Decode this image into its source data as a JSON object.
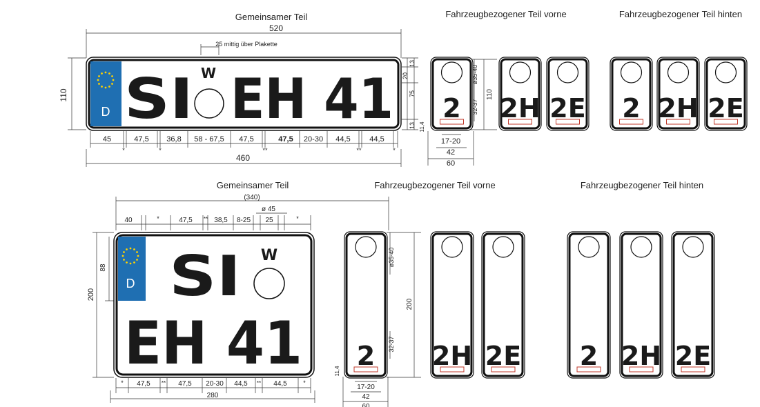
{
  "colors": {
    "eu_band": "#1f6fb2",
    "stars": "#ffd200",
    "plate_border": "#111111",
    "sticker_red": "#c0392b",
    "dim_line": "#333333"
  },
  "top": {
    "headings": {
      "common": "Gemeinsamer Teil",
      "front": "Fahrzeugbezogener Teil vorne",
      "rear": "Fahrzeugbezogener Teil hinten"
    },
    "plate": {
      "eu_letter": "D",
      "text_left": "SI",
      "text_right": "EH 41",
      "w_mark": "W"
    },
    "dims": {
      "overall_width": "520",
      "inner_width": "460",
      "height": "110",
      "badge_note": "25 mittig über Plakette",
      "right_side": [
        "20",
        "13",
        "75",
        "13"
      ],
      "bottom": [
        "45",
        "47,5",
        "36,8",
        "58 - 67,5",
        "47,5",
        "47,5",
        "20-30",
        "44,5",
        "44,5"
      ],
      "stars": [
        "*",
        "*",
        "**",
        "**",
        "*"
      ],
      "tab_side": [
        "ø35-40",
        "32-37",
        "110",
        "11,4"
      ],
      "tab_bottom": [
        "17-20",
        "42",
        "60"
      ]
    },
    "front_tabs": [
      "2",
      "2H",
      "2E"
    ],
    "rear_tabs": [
      "2",
      "2H",
      "2E"
    ]
  },
  "bottom": {
    "headings": {
      "common": "Gemeinsamer Teil",
      "front": "Fahrzeugbezogener Teil vorne",
      "rear": "Fahrzeugbezogener Teil hinten"
    },
    "plate": {
      "eu_letter": "D",
      "line1": "SI",
      "line2": "EH 41",
      "w_mark": "W"
    },
    "dims": {
      "overall_width": "(340)",
      "inner_width": "280",
      "height": "200",
      "eu_height": "88",
      "top_row": [
        "40",
        "*",
        "47,5",
        "**",
        "38,5",
        "8-25",
        "25",
        "*"
      ],
      "badge_dia": "ø 45",
      "bottom_row": [
        "*",
        "47,5",
        "**",
        "47,5",
        "20-30",
        "44,5",
        "**",
        "44,5",
        "*"
      ],
      "tab_side": [
        "ø35-40",
        "200",
        "32-37",
        "11,4"
      ],
      "tab_bottom": [
        "17-20",
        "42",
        "60"
      ]
    },
    "front_tabs": [
      "2",
      "2H",
      "2E"
    ],
    "rear_tabs": [
      "2",
      "2H",
      "2E"
    ]
  }
}
